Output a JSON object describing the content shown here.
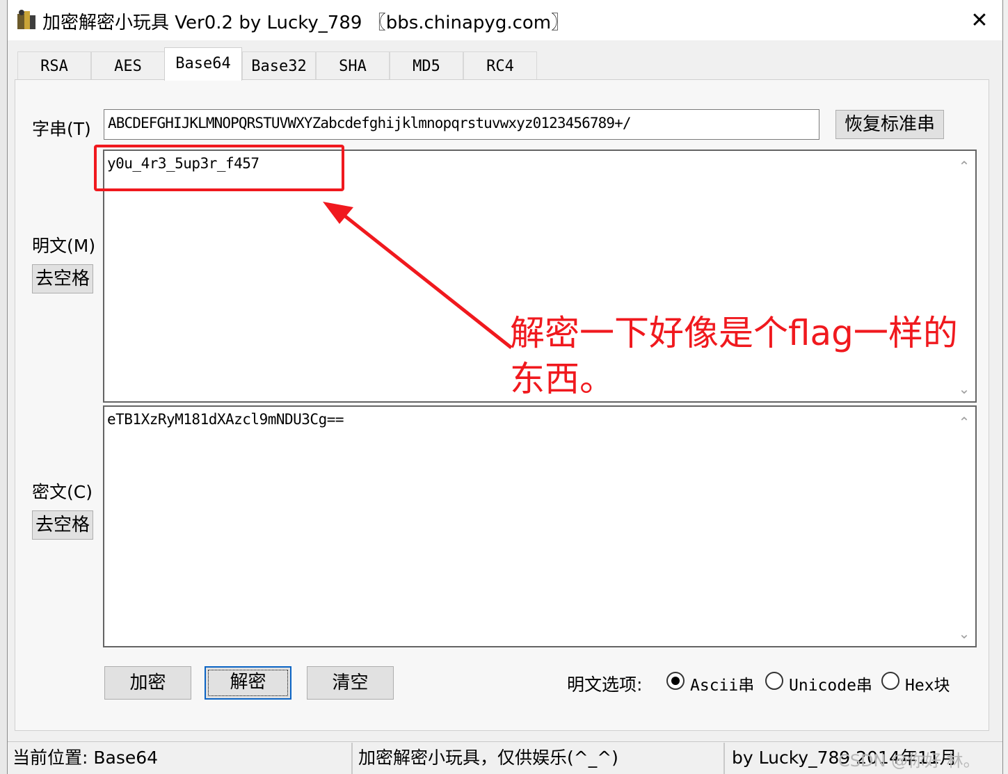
{
  "window": {
    "title": "加密解密小玩具 Ver0.2 by Lucky_789 〖bbs.chinapyg.com〗",
    "close_symbol": "✕"
  },
  "tabs": [
    {
      "label": "RSA",
      "active": false
    },
    {
      "label": "AES",
      "active": false
    },
    {
      "label": "Base64",
      "active": true
    },
    {
      "label": "Base32",
      "active": false
    },
    {
      "label": "SHA",
      "active": false
    },
    {
      "label": "MD5",
      "active": false
    },
    {
      "label": "RC4",
      "active": false
    }
  ],
  "charset": {
    "label": "字串(T)",
    "value": "ABCDEFGHIJKLMNOPQRSTUVWXYZabcdefghijklmnopqrstuvwxyz0123456789+/",
    "restore_button": "恢复标准串"
  },
  "plaintext": {
    "label": "明文(M)",
    "strip_button": "去空格",
    "value": "y0u_4r3_5up3r_f457"
  },
  "ciphertext": {
    "label": "密文(C)",
    "strip_button": "去空格",
    "value": "eTB1XzRyM181dXAzcl9mNDU3Cg=="
  },
  "actions": {
    "encrypt": "加密",
    "decrypt": "解密",
    "clear": "清空"
  },
  "plaintext_options": {
    "label": "明文选项:",
    "options": [
      {
        "label": "Ascii串",
        "selected": true
      },
      {
        "label": "Unicode串",
        "selected": false
      },
      {
        "label": "Hex块",
        "selected": false
      }
    ]
  },
  "status_bar": {
    "location": "当前位置: Base64",
    "message": "加密解密小玩具，仅供娱乐(^_^)",
    "author": "by Lucky_789 2014年11月"
  },
  "annotation": {
    "line1": "解密一下好像是个flag一样的",
    "line2": "东西。",
    "color": "#f0191e"
  },
  "watermark": "CSDN @你好 林。",
  "scroll_icons": {
    "up": "⌃",
    "down": "⌄"
  }
}
